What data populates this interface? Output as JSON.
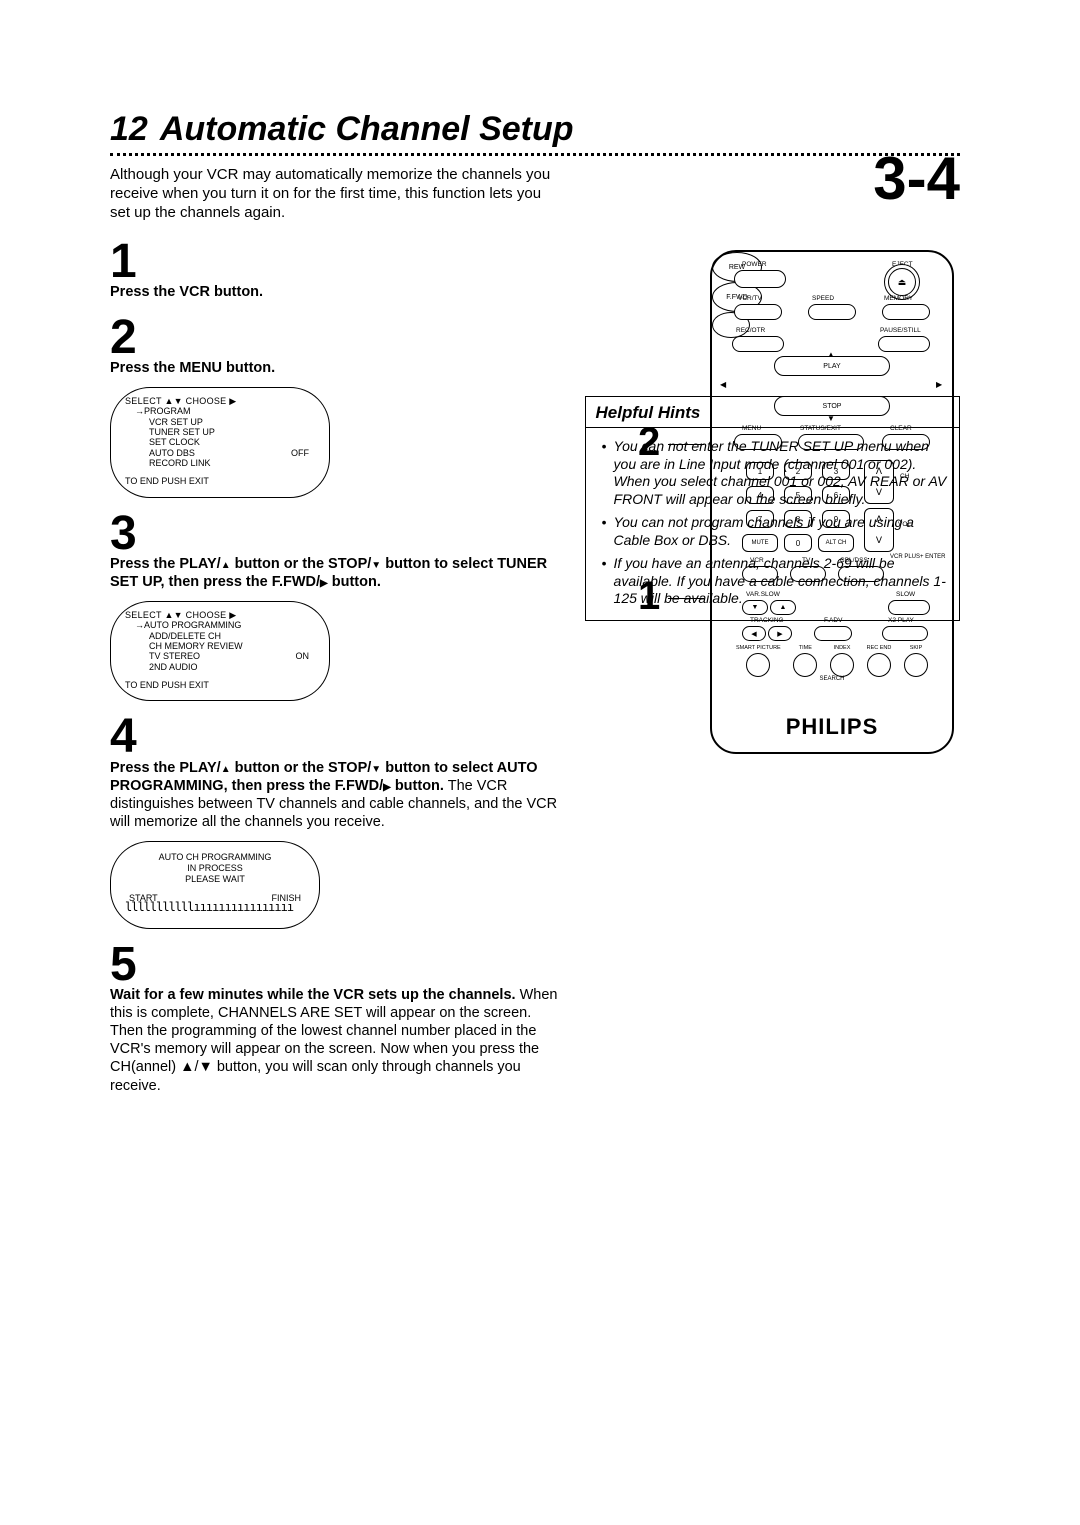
{
  "header": {
    "page_number": "12",
    "title": "Automatic Channel Setup",
    "section_indicator": "3-4"
  },
  "intro": "Although your VCR may automatically memorize the channels you receive when you turn it on for the first time, this function lets you set up the channels again.",
  "steps": {
    "s1": {
      "num": "1",
      "text_bold": "Press the VCR button."
    },
    "s2": {
      "num": "2",
      "text_bold": "Press the MENU button."
    },
    "s3": {
      "num": "3",
      "text_bold_a": "Press the PLAY/",
      "text_bold_b": " button or the STOP/",
      "text_bold_c": " button to select TUNER SET UP, then press the F.FWD/",
      "text_bold_d": " button."
    },
    "s4": {
      "num": "4",
      "text_bold_a": "Press the PLAY/",
      "text_bold_b": " button or the STOP/",
      "text_bold_c": " button to select AUTO PROGRAMMING, then press the F.FWD/",
      "text_bold_d": " button.",
      "text_plain": " The VCR distinguishes between TV channels and cable channels, and the VCR will memorize all the channels you receive."
    },
    "s5": {
      "num": "5",
      "text_bold": "Wait for a few minutes while the VCR sets up the channels.",
      "text_plain": " When this is complete, CHANNELS ARE SET will appear on the screen. Then the programming of the lowest channel number placed in the VCR's memory will appear on the screen. Now when you press the CH(annel) ▲/▼ button, you will scan only through channels you receive."
    }
  },
  "osd1": {
    "header": "SELECT ▲▼ CHOOSE ▶",
    "arrow": "→",
    "items": [
      "PROGRAM",
      "VCR SET UP",
      "TUNER SET UP",
      "SET CLOCK",
      "AUTO DBS",
      "RECORD LINK"
    ],
    "off_label": "OFF",
    "footer": "TO END PUSH EXIT"
  },
  "osd2": {
    "header": "SELECT ▲▼ CHOOSE ▶",
    "arrow": "→",
    "items": [
      "AUTO PROGRAMMING",
      "ADD/DELETE CH",
      "CH MEMORY REVIEW",
      "TV STEREO",
      "2ND AUDIO"
    ],
    "on_label": "ON",
    "footer": "TO END PUSH EXIT"
  },
  "osd3": {
    "line1": "AUTO CH PROGRAMMING",
    "line2": "IN PROCESS",
    "line3": "PLEASE WAIT",
    "start": "START",
    "finish": "FINISH",
    "bar": "lllllllllllıııııııııııııııı"
  },
  "remote": {
    "labels": {
      "power": "POWER",
      "eject": "EJECT",
      "eject_glyph": "⏏",
      "vcrtv": "VCR/TV",
      "speed": "SPEED",
      "memory": "MEMORY",
      "recotr": "REC/OTR",
      "pausestill": "PAUSE/STILL",
      "play": "PLAY",
      "stop": "STOP",
      "rew": "REW",
      "ffwd": "F.FWD",
      "menu": "MENU",
      "statusexit": "STATUS/EXIT",
      "clear": "CLEAR",
      "ch": "CH",
      "vol": "VOL",
      "mute": "MUTE",
      "altch": "ALT CH",
      "vcr": "VCR",
      "tv": "TV",
      "cbldss": "CBL/DSS",
      "vcrplus": "VCR PLUS+\nENTER",
      "varslow": "VAR.SLOW",
      "slow": "SLOW",
      "tracking": "TRACKING",
      "fadv": "F.ADV",
      "x2play": "X2 PLAY",
      "bottom": [
        "SMART\nPICTURE",
        "TIME",
        "INDEX",
        "REC END",
        "SKIP"
      ],
      "search": "SEARCH",
      "brand": "PHILIPS"
    },
    "keypad": [
      "1",
      "2",
      "3",
      "4",
      "5",
      "6",
      "7",
      "8",
      "9",
      "0"
    ],
    "ref_2": "2",
    "ref_1": "1"
  },
  "hints": {
    "title": "Helpful Hints",
    "items": [
      "You can not enter the TUNER SET UP menu when you are in Line Input mode (channel 001 or 002). When you select channel 001 or 002, AV REAR or AV FRONT will appear on the screen briefly.",
      "You can not program channels if you are using a Cable Box or DBS.",
      "If you have an antenna, channels 2-69 will be available. If you have a cable connection, channels 1-125 will be available."
    ]
  }
}
